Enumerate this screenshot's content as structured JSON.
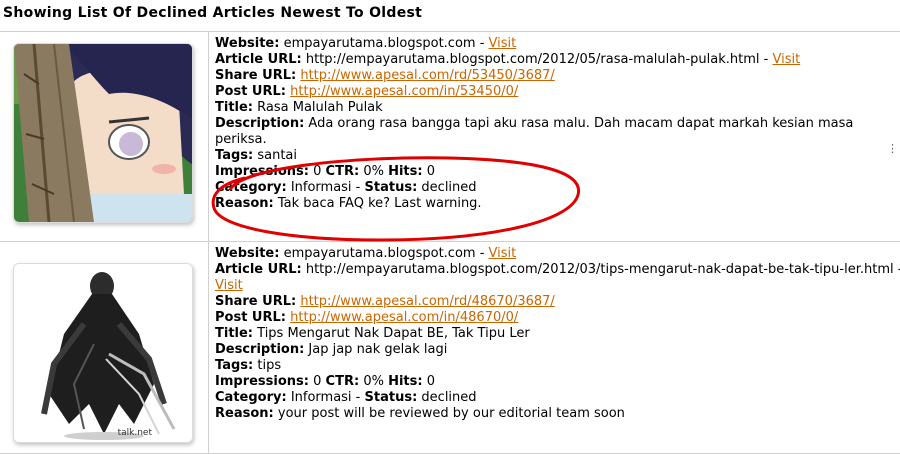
{
  "page": {
    "title": "Showing List Of Declined Articles Newest To Oldest"
  },
  "labels": {
    "website": "Website:",
    "article_url": "Article URL:",
    "share_url": "Share URL:",
    "post_url": "Post URL:",
    "title": "Title:",
    "description": "Description:",
    "tags": "Tags:",
    "impressions": "Impressions:",
    "ctr": "CTR:",
    "hits": "Hits:",
    "category": "Category:",
    "status": "Status:",
    "reason": "Reason:",
    "visit": "Visit",
    "sep": " - "
  },
  "articles": [
    {
      "website": "empayarutama.blogspot.com",
      "article_url": "http://empayarutama.blogspot.com/2012/05/rasa-malulah-pulak.html",
      "share_url": "http://www.apesal.com/rd/53450/3687/",
      "post_url": "http://www.apesal.com/in/53450/0/",
      "title": "Rasa Malulah Pulak",
      "description": "Ada orang rasa bangga tapi aku rasa malu. Dah macam dapat markah kesian masa periksa.",
      "tags": "santai",
      "impressions": "0",
      "ctr": "0%",
      "hits": "0",
      "category": "Informasi",
      "status": "declined",
      "reason": "Tak baca FAQ ke? Last warning."
    },
    {
      "website": "empayarutama.blogspot.com",
      "article_url": "http://empayarutama.blogspot.com/2012/03/tips-mengarut-nak-dapat-be-tak-tipu-ler.html",
      "share_url": "http://www.apesal.com/rd/48670/3687/",
      "post_url": "http://www.apesal.com/in/48670/0/",
      "title": "Tips Mengarut Nak Dapat BE, Tak Tipu Ler",
      "description": "Jap jap nak gelak lagi",
      "tags": "tips",
      "impressions": "0",
      "ctr": "0%",
      "hits": "0",
      "category": "Informasi",
      "status": "declined",
      "reason": "your post will be reviewed by our editorial team soon"
    }
  ],
  "thumb_caption_2": "talk.net",
  "colors": {
    "link": "#cc6600",
    "annotation": "#e00000",
    "border": "#d0d0d0"
  }
}
